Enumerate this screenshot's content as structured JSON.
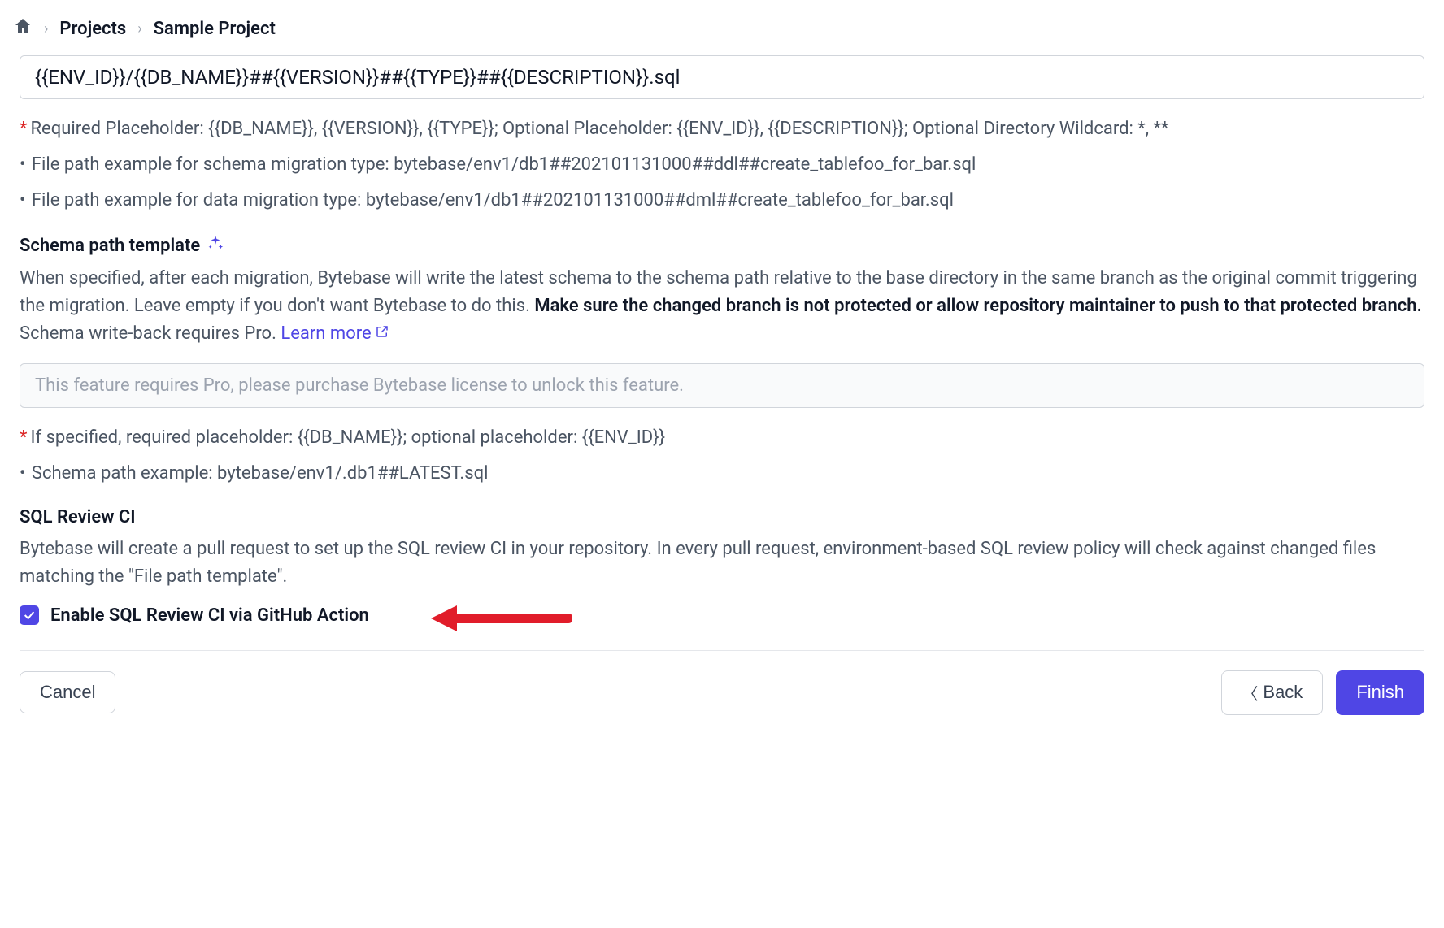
{
  "breadcrumb": {
    "projects": "Projects",
    "current": "Sample Project"
  },
  "file_path_input": "{{ENV_ID}}/{{DB_NAME}}##{{VERSION}}##{{TYPE}}##{{DESCRIPTION}}.sql",
  "required_help": "Required Placeholder: {{DB_NAME}}, {{VERSION}}, {{TYPE}}; Optional Placeholder: {{ENV_ID}}, {{DESCRIPTION}}; Optional Directory Wildcard: *, **",
  "bullets_file": [
    "File path example for schema migration type: bytebase/env1/db1##202101131000##ddl##create_tablefoo_for_bar.sql",
    "File path example for data migration type: bytebase/env1/db1##202101131000##dml##create_tablefoo_for_bar.sql"
  ],
  "schema_section": {
    "title": "Schema path template",
    "desc_1": "When specified, after each migration, Bytebase will write the latest schema to the schema path relative to the base directory in the same branch as the original commit triggering the migration. Leave empty if you don't want Bytebase to do this. ",
    "desc_bold": "Make sure the changed branch is not protected or allow repository maintainer to push to that protected branch.",
    "desc_2": " Schema write-back requires Pro. ",
    "learn_more": "Learn more",
    "placeholder": "This feature requires Pro, please purchase Bytebase license to unlock this feature.",
    "required_help": "If specified,  required placeholder: {{DB_NAME}}; optional placeholder: {{ENV_ID}}",
    "example": "Schema path example: bytebase/env1/.db1##LATEST.sql"
  },
  "sql_review": {
    "title": "SQL Review CI",
    "desc": "Bytebase will create a pull request to set up the SQL review CI in your repository. In every pull request, environment-based SQL review policy will check against changed files matching the \"File path template\".",
    "checkbox_label": "Enable SQL Review CI via GitHub Action"
  },
  "footer": {
    "cancel": "Cancel",
    "back": "Back",
    "finish": "Finish"
  }
}
